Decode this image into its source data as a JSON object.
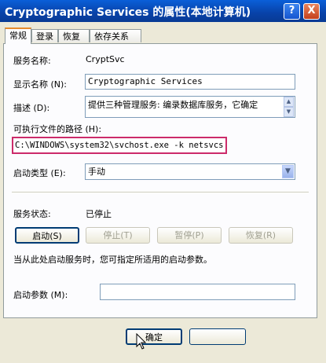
{
  "window": {
    "title": "Cryptographic Services 的属性(本地计算机)",
    "help_btn": "?",
    "close_btn": "X"
  },
  "tabs": [
    "常规",
    "登录",
    "恢复",
    "依存关系"
  ],
  "general": {
    "service_name_label": "服务名称:",
    "service_name_value": "CryptSvc",
    "display_name_label": "显示名称 (N):",
    "display_name_value": "Cryptographic Services",
    "description_label": "描述 (D):",
    "description_value": "提供三种管理服务: 编录数据库服务，它确定",
    "exe_path_label": "可执行文件的路径 (H):",
    "exe_path_value": "C:\\WINDOWS\\system32\\svchost.exe -k netsvcs",
    "startup_type_label": "启动类型 (E):",
    "startup_type_value": "手动",
    "status_label": "服务状态:",
    "status_value": "已停止",
    "start_btn": "启动(S)",
    "stop_btn": "停止(T)",
    "pause_btn": "暂停(P)",
    "resume_btn": "恢复(R)",
    "hint": "当从此处启动服务时，您可指定所适用的启动参数。",
    "params_label": "启动参数 (M):",
    "params_value": ""
  },
  "footer": {
    "ok_btn": "确定"
  },
  "colors": {
    "titlebar": "#0842a8",
    "highlight_box": "#cc2b6a",
    "tab_accent": "#e68b2c"
  }
}
